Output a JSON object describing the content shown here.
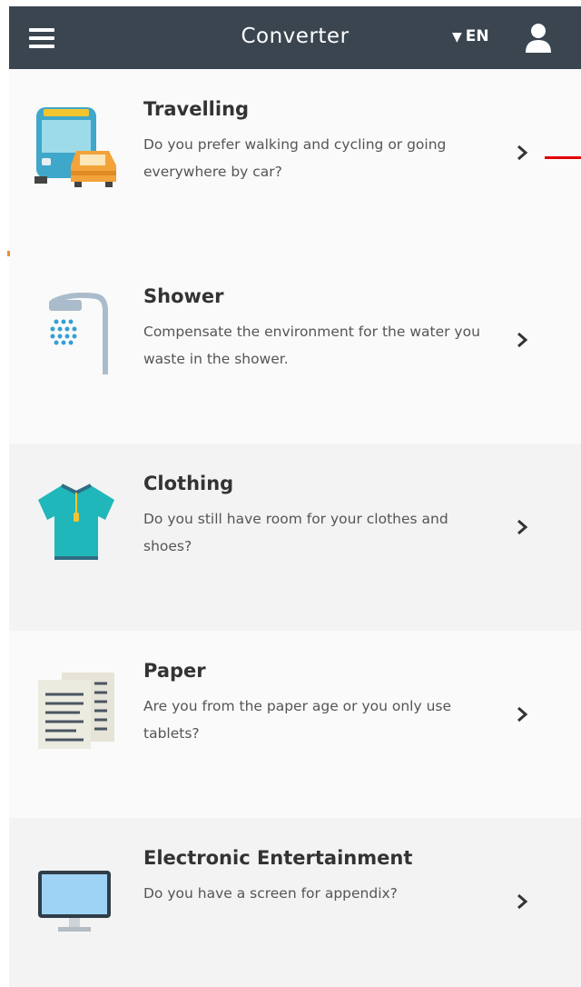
{
  "header": {
    "title": "Converter",
    "language": "EN",
    "icons": [
      "hamburger-menu-icon",
      "dropdown-triangle-icon",
      "user-icon"
    ]
  },
  "items": [
    {
      "title": "Travelling",
      "description": "Do you prefer walking and cycling or going everywhere by car?",
      "icon": "bus-and-car-icon"
    },
    {
      "title": "Shower",
      "description": "Compensate the environment for the water you waste in the shower.",
      "icon": "shower-icon"
    },
    {
      "title": "Clothing",
      "description": "Do you still have room for your clothes and shoes?",
      "icon": "t-shirt-icon"
    },
    {
      "title": "Paper",
      "description": "Are you from the paper age or you only use tablets?",
      "icon": "paper-documents-icon"
    },
    {
      "title": "Electronic Entertainment",
      "description": "Do you have a screen for appendix?",
      "icon": "monitor-icon"
    }
  ],
  "colors": {
    "header_bg": "#3a4550",
    "accent_red": "#e00000"
  }
}
